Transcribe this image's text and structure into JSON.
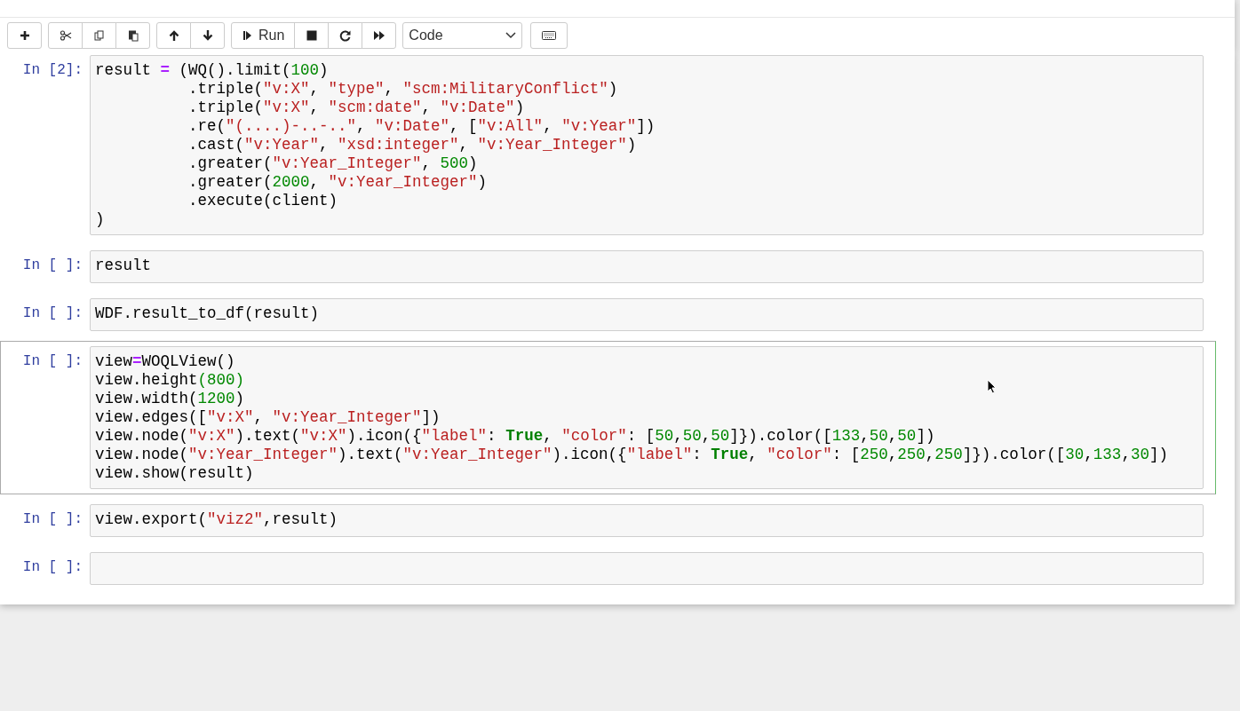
{
  "toolbar": {
    "groups": [
      [
        {
          "kind": "plus"
        }
      ],
      [
        {
          "kind": "cut"
        },
        {
          "kind": "copy"
        },
        {
          "kind": "paste"
        }
      ],
      [
        {
          "kind": "up"
        },
        {
          "kind": "down"
        }
      ],
      [
        {
          "kind": "run",
          "label": "Run"
        },
        {
          "kind": "stop"
        },
        {
          "kind": "restart"
        },
        {
          "kind": "fastforward"
        }
      ]
    ],
    "cell_type": {
      "value": "Code"
    },
    "keyboard": {
      "kind": "keyboard"
    }
  },
  "cells": [
    {
      "prompt": "In [2]:",
      "selected": false,
      "lines": [
        [
          {
            "kind": "plain",
            "text": "result "
          },
          {
            "kind": "operator",
            "text": "="
          },
          {
            "kind": "plain",
            "text": " (WQ().limit("
          },
          {
            "kind": "number",
            "text": "100"
          },
          {
            "kind": "plain",
            "text": ")"
          }
        ],
        [
          {
            "kind": "plain",
            "text": "          .triple("
          },
          {
            "kind": "string",
            "text": "\"v:X\""
          },
          {
            "kind": "plain",
            "text": ", "
          },
          {
            "kind": "string",
            "text": "\"type\""
          },
          {
            "kind": "plain",
            "text": ", "
          },
          {
            "kind": "string",
            "text": "\"scm:MilitaryConflict\""
          },
          {
            "kind": "plain",
            "text": ")"
          }
        ],
        [
          {
            "kind": "plain",
            "text": "          .triple("
          },
          {
            "kind": "string",
            "text": "\"v:X\""
          },
          {
            "kind": "plain",
            "text": ", "
          },
          {
            "kind": "string",
            "text": "\"scm:date\""
          },
          {
            "kind": "plain",
            "text": ", "
          },
          {
            "kind": "string",
            "text": "\"v:Date\""
          },
          {
            "kind": "plain",
            "text": ")"
          }
        ],
        [
          {
            "kind": "plain",
            "text": "          .re("
          },
          {
            "kind": "string",
            "text": "\"(....)-..-..\""
          },
          {
            "kind": "plain",
            "text": ", "
          },
          {
            "kind": "string",
            "text": "\"v:Date\""
          },
          {
            "kind": "plain",
            "text": ", ["
          },
          {
            "kind": "string",
            "text": "\"v:All\""
          },
          {
            "kind": "plain",
            "text": ", "
          },
          {
            "kind": "string",
            "text": "\"v:Year\""
          },
          {
            "kind": "plain",
            "text": "])"
          }
        ],
        [
          {
            "kind": "plain",
            "text": "          .cast("
          },
          {
            "kind": "string",
            "text": "\"v:Year\""
          },
          {
            "kind": "plain",
            "text": ", "
          },
          {
            "kind": "string",
            "text": "\"xsd:integer\""
          },
          {
            "kind": "plain",
            "text": ", "
          },
          {
            "kind": "string",
            "text": "\"v:Year_Integer\""
          },
          {
            "kind": "plain",
            "text": ")"
          }
        ],
        [
          {
            "kind": "plain",
            "text": "          .greater("
          },
          {
            "kind": "string",
            "text": "\"v:Year_Integer\""
          },
          {
            "kind": "plain",
            "text": ", "
          },
          {
            "kind": "number",
            "text": "500"
          },
          {
            "kind": "plain",
            "text": ")"
          }
        ],
        [
          {
            "kind": "plain",
            "text": "          .greater("
          },
          {
            "kind": "number",
            "text": "2000"
          },
          {
            "kind": "plain",
            "text": ", "
          },
          {
            "kind": "string",
            "text": "\"v:Year_Integer\""
          },
          {
            "kind": "plain",
            "text": ")"
          }
        ],
        [
          {
            "kind": "plain",
            "text": "          .execute(client)"
          }
        ],
        [
          {
            "kind": "plain",
            "text": ")"
          }
        ]
      ]
    },
    {
      "prompt": "In [ ]:",
      "selected": false,
      "lines": [
        [
          {
            "kind": "plain",
            "text": "result"
          }
        ]
      ]
    },
    {
      "prompt": "In [ ]:",
      "selected": false,
      "lines": [
        [
          {
            "kind": "plain",
            "text": "WDF.result_to_df(result)"
          }
        ]
      ]
    },
    {
      "prompt": "In [ ]:",
      "selected": true,
      "lines": [
        [
          {
            "kind": "plain",
            "text": "view"
          },
          {
            "kind": "operator",
            "text": "="
          },
          {
            "kind": "plain",
            "text": "WOQLView()"
          }
        ],
        [
          {
            "kind": "plain",
            "text": "view.height"
          },
          {
            "kind": "number",
            "text": "(800)"
          }
        ],
        [
          {
            "kind": "plain",
            "text": "view.width("
          },
          {
            "kind": "number",
            "text": "1200"
          },
          {
            "kind": "plain",
            "text": ")"
          }
        ],
        [
          {
            "kind": "plain",
            "text": "view.edges(["
          },
          {
            "kind": "string",
            "text": "\"v:X\""
          },
          {
            "kind": "plain",
            "text": ", "
          },
          {
            "kind": "string",
            "text": "\"v:Year_Integer\""
          },
          {
            "kind": "plain",
            "text": "])"
          }
        ],
        [
          {
            "kind": "plain",
            "text": "view.node("
          },
          {
            "kind": "string",
            "text": "\"v:X\""
          },
          {
            "kind": "plain",
            "text": ").text("
          },
          {
            "kind": "string",
            "text": "\"v:X\""
          },
          {
            "kind": "plain",
            "text": ").icon({"
          },
          {
            "kind": "string",
            "text": "\"label\""
          },
          {
            "kind": "plain",
            "text": ": "
          },
          {
            "kind": "keyword",
            "text": "True"
          },
          {
            "kind": "plain",
            "text": ", "
          },
          {
            "kind": "string",
            "text": "\"color\""
          },
          {
            "kind": "plain",
            "text": ": ["
          },
          {
            "kind": "number",
            "text": "50"
          },
          {
            "kind": "plain",
            "text": ","
          },
          {
            "kind": "number",
            "text": "50"
          },
          {
            "kind": "plain",
            "text": ","
          },
          {
            "kind": "number",
            "text": "50"
          },
          {
            "kind": "plain",
            "text": "]}).color(["
          },
          {
            "kind": "number",
            "text": "133"
          },
          {
            "kind": "plain",
            "text": ","
          },
          {
            "kind": "number",
            "text": "50"
          },
          {
            "kind": "plain",
            "text": ","
          },
          {
            "kind": "number",
            "text": "50"
          },
          {
            "kind": "plain",
            "text": "])"
          }
        ],
        [
          {
            "kind": "plain",
            "text": "view.node("
          },
          {
            "kind": "string",
            "text": "\"v:Year_Integer\""
          },
          {
            "kind": "plain",
            "text": ").text("
          },
          {
            "kind": "string",
            "text": "\"v:Year_Integer\""
          },
          {
            "kind": "plain",
            "text": ").icon({"
          },
          {
            "kind": "string",
            "text": "\"label\""
          },
          {
            "kind": "plain",
            "text": ": "
          },
          {
            "kind": "keyword",
            "text": "True"
          },
          {
            "kind": "plain",
            "text": ", "
          },
          {
            "kind": "string",
            "text": "\"color\""
          },
          {
            "kind": "plain",
            "text": ": ["
          },
          {
            "kind": "number",
            "text": "250"
          },
          {
            "kind": "plain",
            "text": ","
          },
          {
            "kind": "number",
            "text": "250"
          },
          {
            "kind": "plain",
            "text": ","
          },
          {
            "kind": "number",
            "text": "250"
          },
          {
            "kind": "plain",
            "text": "]}).color(["
          },
          {
            "kind": "number",
            "text": "30"
          },
          {
            "kind": "plain",
            "text": ","
          },
          {
            "kind": "number",
            "text": "133"
          },
          {
            "kind": "plain",
            "text": ","
          },
          {
            "kind": "number",
            "text": "30"
          },
          {
            "kind": "plain",
            "text": "])"
          }
        ],
        [
          {
            "kind": "plain",
            "text": "view.show(result)"
          }
        ]
      ]
    },
    {
      "prompt": "In [ ]:",
      "selected": false,
      "lines": [
        [
          {
            "kind": "plain",
            "text": "view.export("
          },
          {
            "kind": "string",
            "text": "\"viz2\""
          },
          {
            "kind": "plain",
            "text": ",result)"
          }
        ]
      ]
    },
    {
      "prompt": "In [ ]:",
      "selected": false
    }
  ]
}
